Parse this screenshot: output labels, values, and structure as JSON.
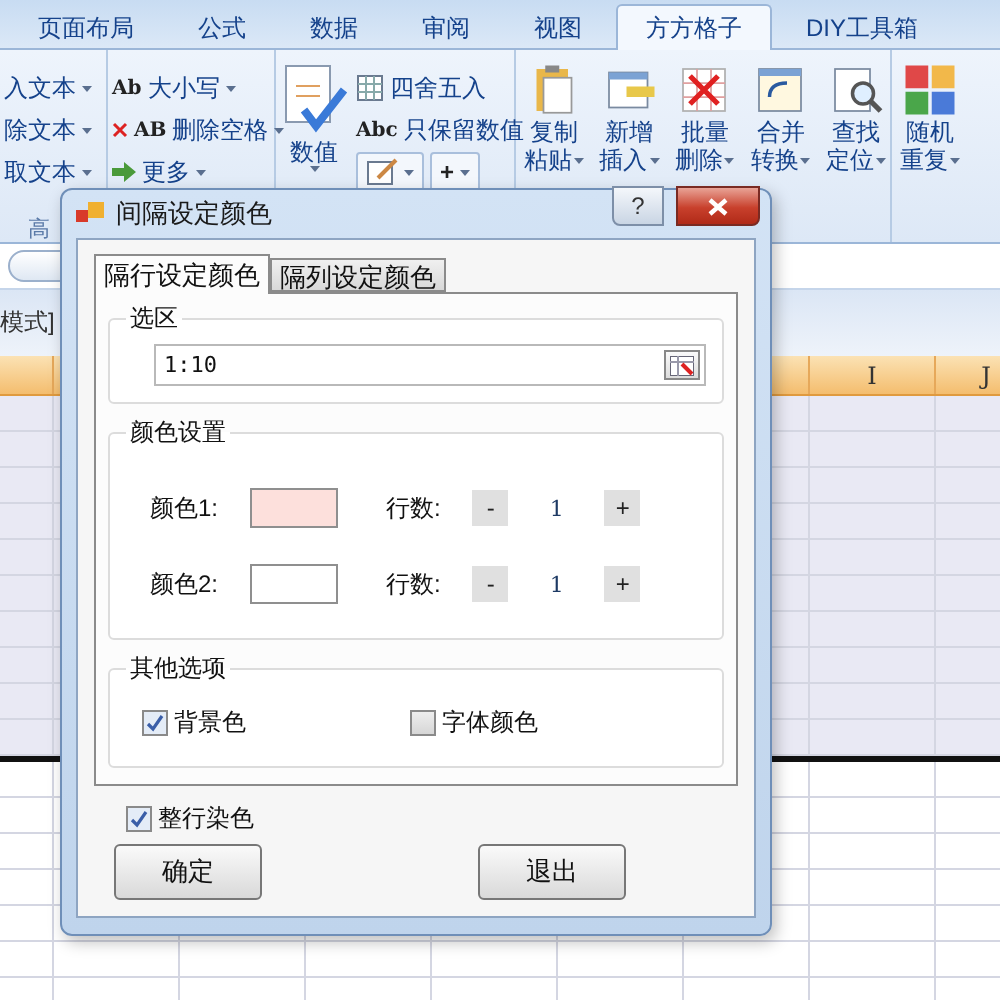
{
  "ribbon_tabs": [
    {
      "label": "页面布局",
      "selected": false
    },
    {
      "label": "公式",
      "selected": false
    },
    {
      "label": "数据",
      "selected": false
    },
    {
      "label": "审阅",
      "selected": false
    },
    {
      "label": "视图",
      "selected": false
    },
    {
      "label": "方方格子",
      "selected": true
    },
    {
      "label": "DIY工具箱",
      "selected": false
    }
  ],
  "ribbon": {
    "text_group": {
      "items": [
        {
          "label": "入文本"
        },
        {
          "label": "除文本"
        },
        {
          "label": "取文本"
        }
      ],
      "footer": "高"
    },
    "case_group": {
      "items": [
        {
          "badge": "Ab",
          "label": "大小写"
        },
        {
          "badge": "AB",
          "label": "删除空格"
        },
        {
          "label": "更多"
        }
      ]
    },
    "number_group": {
      "large": {
        "label": "数值"
      },
      "items": [
        {
          "label": "四舍五入"
        },
        {
          "badge": "Abc",
          "label": "只保留数值"
        }
      ],
      "plus": "+"
    },
    "cell_group": {
      "items": [
        {
          "line1": "复制",
          "line2": "粘贴"
        },
        {
          "line1": "新增",
          "line2": "插入"
        },
        {
          "line1": "批量",
          "line2": "删除"
        },
        {
          "line1": "合并",
          "line2": "转换"
        },
        {
          "line1": "查找",
          "line2": "定位"
        }
      ]
    },
    "random_group": {
      "items": [
        {
          "line1": "随机",
          "line2": "重复"
        }
      ]
    }
  },
  "sheet": {
    "mode_label": "模式]",
    "columns": [
      "I",
      "J"
    ]
  },
  "dialog": {
    "title": "间隔设定颜色",
    "help": "?",
    "tabs": [
      {
        "label": "隔行设定颜色",
        "selected": true
      },
      {
        "label": "隔列设定颜色",
        "selected": false
      }
    ],
    "range": {
      "legend": "选区",
      "value": "1:10"
    },
    "colors": {
      "legend": "颜色设置",
      "rows": [
        {
          "label": "颜色1:",
          "color": "#fde0dc",
          "count_label": "行数:",
          "minus": "-",
          "count": "1",
          "plus": "+"
        },
        {
          "label": "颜色2:",
          "color": "#ffffff",
          "count_label": "行数:",
          "minus": "-",
          "count": "1",
          "plus": "+"
        }
      ]
    },
    "other": {
      "legend": "其他选项",
      "options": [
        {
          "label": "背景色",
          "checked": true
        },
        {
          "label": "字体颜色",
          "checked": false
        }
      ]
    },
    "whole_row": {
      "label": "整行染色",
      "checked": true
    },
    "buttons": [
      {
        "label": "确定"
      },
      {
        "label": "退出"
      }
    ]
  }
}
